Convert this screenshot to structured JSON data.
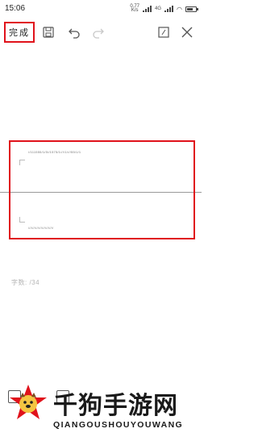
{
  "status_bar": {
    "time": "15:06",
    "network_speed": "0.77",
    "network_unit": "K/s",
    "signal_labels": "4G",
    "battery_level": 0.7
  },
  "toolbar": {
    "done_label": "完成",
    "save_icon": "save-icon",
    "undo_icon": "undo-icon",
    "redo_icon": "redo-icon",
    "edit_icon": "edit-icon",
    "close_icon": "close-icon"
  },
  "editor": {
    "line1": "//111555/1/5//1575/1////1////55/1/1",
    "line2": "////////////////////////"
  },
  "footer": {
    "word_count": "字数: /34"
  },
  "watermark": {
    "title": "千狗手游网",
    "subtitle": "QIANGOUSHOUYOUWANG"
  },
  "colors": {
    "highlight": "#e0121b",
    "divider": "#9a9a9a"
  }
}
